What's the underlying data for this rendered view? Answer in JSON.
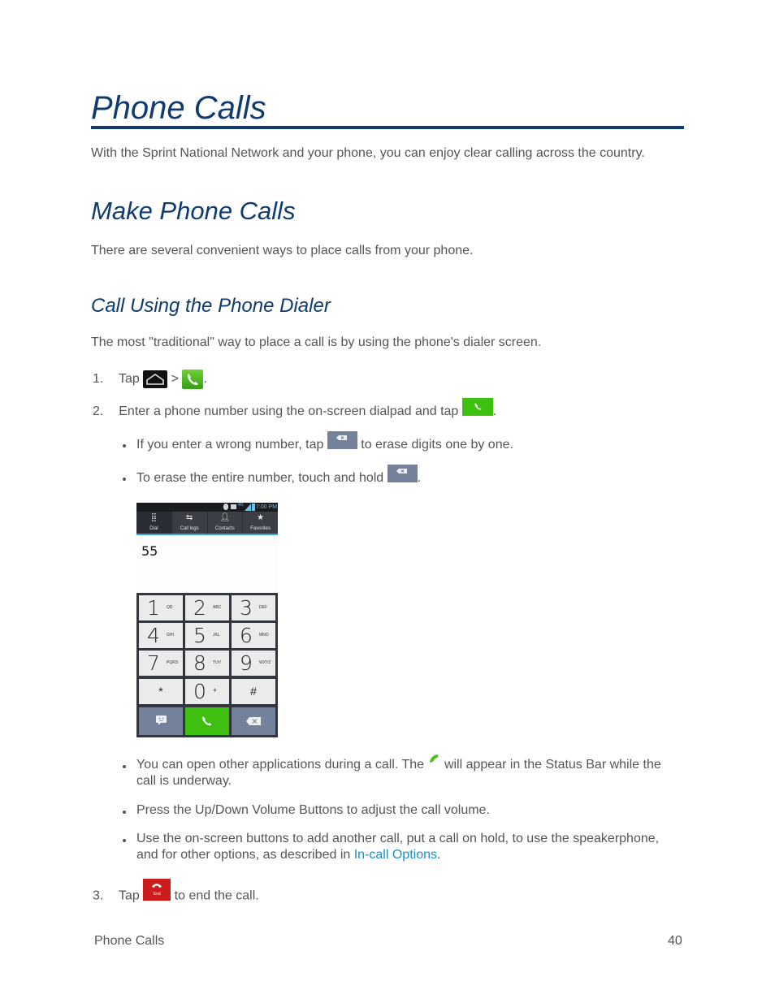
{
  "page": {
    "title": "Phone Calls",
    "intro": "With the Sprint National Network and your phone, you can enjoy clear calling across the country.",
    "section": {
      "title": "Make Phone Calls",
      "intro": "There are several convenient ways to place calls from your phone.",
      "subsection": {
        "title": "Call Using the Phone Dialer",
        "intro": "The most \"traditional\" way to place a call is by using the phone's dialer screen.",
        "steps": [
          {
            "num": "1.",
            "pre": "Tap",
            "mid": ">",
            "post": "."
          },
          {
            "num": "2.",
            "pre": "Enter a phone number using the on-screen dialpad and tap",
            "post": "."
          },
          {
            "num": "3.",
            "pre": "Tap",
            "post": "to end the call."
          }
        ],
        "sub_bullets": [
          {
            "pre": "If you enter a wrong number, tap",
            "post": "to erase digits one by one."
          },
          {
            "pre": "To erase the entire number, touch and hold",
            "post": "."
          }
        ],
        "after_bullets": [
          {
            "pre": "You can open other applications during a call. The",
            "post": "will appear in the Status Bar while the",
            "line2": "call is underway."
          },
          {
            "text": "Press the Up/Down Volume Buttons to adjust the call volume."
          },
          {
            "line1": "Use the on-screen buttons to add another call, put a call on hold, to use the speakerphone,",
            "line2_pre": "and for other options, as described in",
            "link": "In-call Options",
            "line2_post": "."
          }
        ],
        "end_button_label": "End"
      }
    },
    "footer": {
      "left": "Phone Calls",
      "page_number": "40"
    }
  },
  "phone": {
    "status_time": "7:00 PM",
    "tabs": [
      {
        "label": "Dial",
        "icon": "dialpad-icon",
        "active": true
      },
      {
        "label": "Call logs",
        "icon": "call-logs-icon",
        "active": false
      },
      {
        "label": "Contacts",
        "icon": "contacts-icon",
        "active": false
      },
      {
        "label": "Favorites",
        "icon": "star-icon",
        "active": false
      }
    ],
    "dialed_number": "55",
    "keys": [
      {
        "digit": "1",
        "letters": "QD"
      },
      {
        "digit": "2",
        "letters": "ABC"
      },
      {
        "digit": "3",
        "letters": "DEF"
      },
      {
        "digit": "4",
        "letters": "GHI"
      },
      {
        "digit": "5",
        "letters": "JKL"
      },
      {
        "digit": "6",
        "letters": "MNO"
      },
      {
        "digit": "7",
        "letters": "PQRS"
      },
      {
        "digit": "8",
        "letters": "TUV"
      },
      {
        "digit": "9",
        "letters": "WXYZ"
      },
      {
        "digit": "*",
        "letters": ""
      },
      {
        "digit": "0",
        "letters": "+"
      },
      {
        "digit": "#",
        "letters": ""
      }
    ]
  },
  "colors": {
    "heading": "#0f3b6e",
    "link": "#1a8fc4",
    "call_green": "#3fbf10",
    "end_red": "#cc1c1c",
    "gray_button": "#74819a"
  }
}
